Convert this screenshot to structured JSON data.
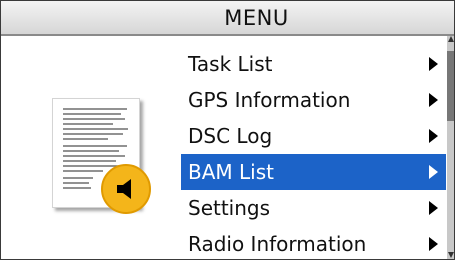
{
  "header": {
    "title": "MENU"
  },
  "preview": {
    "icon": "document-page-icon",
    "badge_icon": "speaker-icon",
    "badge_color": "#f4b51a"
  },
  "menu": {
    "items": [
      {
        "label": "Task List",
        "selected": false
      },
      {
        "label": "GPS Information",
        "selected": false
      },
      {
        "label": "DSC Log",
        "selected": false
      },
      {
        "label": "BAM List",
        "selected": true
      },
      {
        "label": "Settings",
        "selected": false
      },
      {
        "label": "Radio Information",
        "selected": false
      }
    ],
    "selected_color": "#1c63c8"
  }
}
